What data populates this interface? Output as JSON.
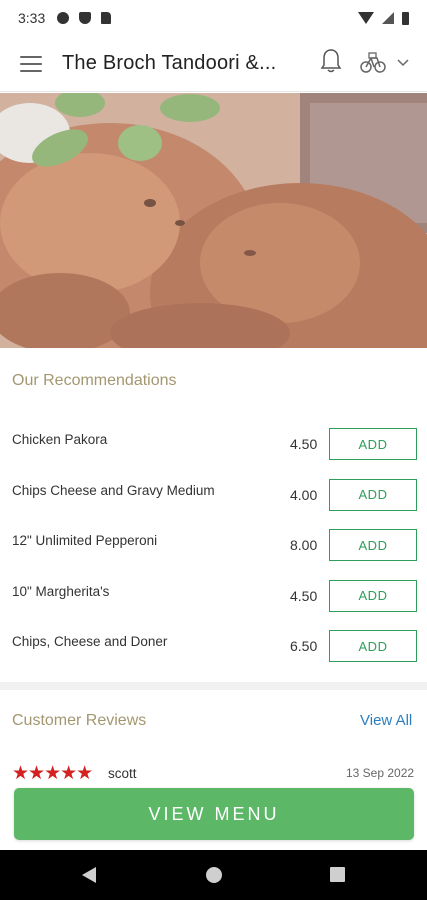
{
  "status_bar": {
    "time": "3:33",
    "icons": [
      "gear-icon",
      "shield-icon",
      "sd-card-icon",
      "wifi-icon",
      "signal-icon",
      "battery-icon"
    ]
  },
  "app_bar": {
    "title": "The Broch Tandoori &...",
    "icons": [
      "menu-icon",
      "bell-icon",
      "delivery-bike-icon",
      "chevron-down-icon"
    ]
  },
  "hero": {
    "alt": "roast chicken with mint leaves"
  },
  "recommendations": {
    "title": "Our Recommendations",
    "items": [
      {
        "name": "Chicken Pakora",
        "price": "4.50",
        "button": "ADD"
      },
      {
        "name": "Chips Cheese and Gravy Medium",
        "price": "4.00",
        "button": "ADD"
      },
      {
        "name": "12\" Unlimited Pepperoni",
        "price": "8.00",
        "button": "ADD"
      },
      {
        "name": "10\" Margherita's",
        "price": "4.50",
        "button": "ADD"
      },
      {
        "name": "Chips, Cheese and Doner",
        "price": "6.50",
        "button": "ADD"
      }
    ]
  },
  "reviews": {
    "title": "Customer Reviews",
    "view_all": "View All",
    "items": [
      {
        "stars": "★★★★★",
        "rating": 5,
        "author": "scott",
        "date": "13 Sep 2022"
      }
    ]
  },
  "view_menu_button": "VIEW MENU",
  "colors": {
    "accent_green": "#5cb867",
    "add_border": "#2e9e5a",
    "section_title": "#a39770",
    "link_blue": "#2a7ec0",
    "star_red": "#d22222"
  }
}
